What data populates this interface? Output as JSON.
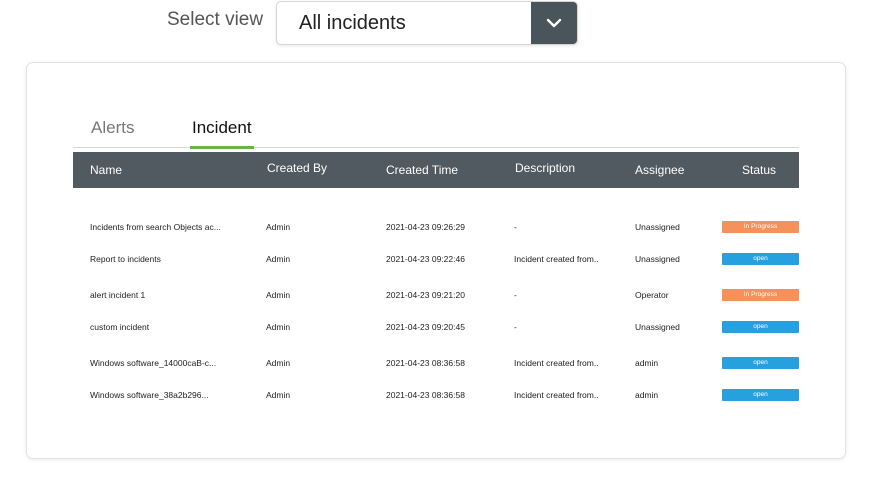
{
  "view_selector": {
    "label": "Select view",
    "selected": "All incidents"
  },
  "tabs": [
    {
      "label": "Alerts",
      "active": false
    },
    {
      "label": "Incident",
      "active": true
    }
  ],
  "table": {
    "columns": [
      "Name",
      "Created By",
      "Created Time",
      "Description",
      "Assignee",
      "Status"
    ],
    "rows": [
      {
        "name": "Incidents from search Objects ac...",
        "created_by": "Admin",
        "created_time": "2021-04-23 09:26:29",
        "description": "-",
        "assignee": "Unassigned",
        "status": "In Progress"
      },
      {
        "name": "Report to incidents",
        "created_by": "Admin",
        "created_time": "2021-04-23 09:22:46",
        "description": "Incident created from..",
        "assignee": "Unassigned",
        "status": "open"
      },
      {
        "name": "alert incident 1",
        "created_by": "Admin",
        "created_time": "2021-04-23 09:21:20",
        "description": "-",
        "assignee": "Operator",
        "status": "In Progress"
      },
      {
        "name": "custom incident",
        "created_by": "Admin",
        "created_time": "2021-04-23 09:20:45",
        "description": "-",
        "assignee": "Unassigned",
        "status": "open"
      },
      {
        "name": "Windows software_14000caB-c...",
        "created_by": "Admin",
        "created_time": "2021-04-23 08:36:58",
        "description": "Incident created from..",
        "assignee": "admin",
        "status": "open"
      },
      {
        "name": "Windows software_38a2b296...",
        "created_by": "Admin",
        "created_time": "2021-04-23 08:36:58",
        "description": "Incident created from..",
        "assignee": "admin",
        "status": "open"
      }
    ]
  },
  "colors": {
    "accent_green": "#6cb33f",
    "header_dark": "#515a60",
    "status_in_progress": "#f5915a",
    "status_open": "#27a0df"
  },
  "icons": {
    "dropdown": "chevron-down-icon"
  }
}
